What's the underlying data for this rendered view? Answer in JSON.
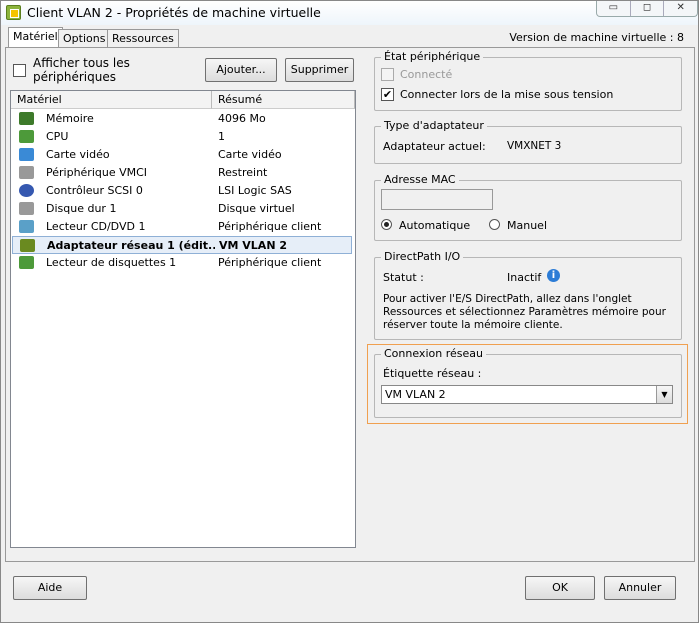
{
  "window": {
    "title": "Client VLAN 2 - Propriétés de machine virtuelle",
    "minimize": "▭",
    "maximize": "◻",
    "close": "✕"
  },
  "tabs": [
    {
      "label": "Matériel"
    },
    {
      "label": "Options"
    },
    {
      "label": "Ressources"
    }
  ],
  "version": "Version de machine virtuelle : 8",
  "left": {
    "show_all_label": "Afficher tous les périphériques",
    "add_label": "Ajouter...",
    "remove_label": "Supprimer",
    "columns": [
      "Matériel",
      "Résumé"
    ],
    "rows": [
      {
        "name": "Mémoire",
        "summary": "4096 Mo",
        "icon": "memory-icon"
      },
      {
        "name": "CPU",
        "summary": "1",
        "icon": "cpu-icon"
      },
      {
        "name": "Carte vidéo",
        "summary": "Carte vidéo",
        "icon": "monitor-icon"
      },
      {
        "name": "Périphérique VMCI",
        "summary": "Restreint",
        "icon": "device-icon"
      },
      {
        "name": "Contrôleur SCSI 0",
        "summary": "LSI Logic SAS",
        "icon": "scsi-icon"
      },
      {
        "name": "Disque dur 1",
        "summary": "Disque virtuel",
        "icon": "disk-icon"
      },
      {
        "name": "Lecteur CD/DVD 1",
        "summary": "Périphérique client",
        "icon": "cd-icon"
      },
      {
        "name": "Adaptateur réseau 1 (édit...",
        "summary": "VM VLAN 2",
        "icon": "network-card-icon"
      },
      {
        "name": "Lecteur de disquettes 1",
        "summary": "Périphérique client",
        "icon": "floppy-icon"
      }
    ]
  },
  "device_state": {
    "legend": "État périphérique",
    "connected": "Connecté",
    "connect_at_power_on": "Connecter lors de la mise sous tension"
  },
  "adapter_type": {
    "legend": "Type d'adaptateur",
    "label": "Adaptateur actuel:",
    "value": "VMXNET 3"
  },
  "mac": {
    "legend": "Adresse MAC",
    "value": "",
    "automatic": "Automatique",
    "manual": "Manuel"
  },
  "directpath": {
    "legend": "DirectPath I/O",
    "status_label": "Statut :",
    "status_value": "Inactif",
    "info": "Pour activer l'E/S DirectPath, allez dans l'onglet Ressources et sélectionnez Paramètres mémoire pour réserver toute la mémoire cliente."
  },
  "network": {
    "legend": "Connexion réseau",
    "label": "Étiquette réseau :",
    "value": "VM VLAN 2"
  },
  "footer": {
    "help": "Aide",
    "ok": "OK",
    "cancel": "Annuler"
  }
}
